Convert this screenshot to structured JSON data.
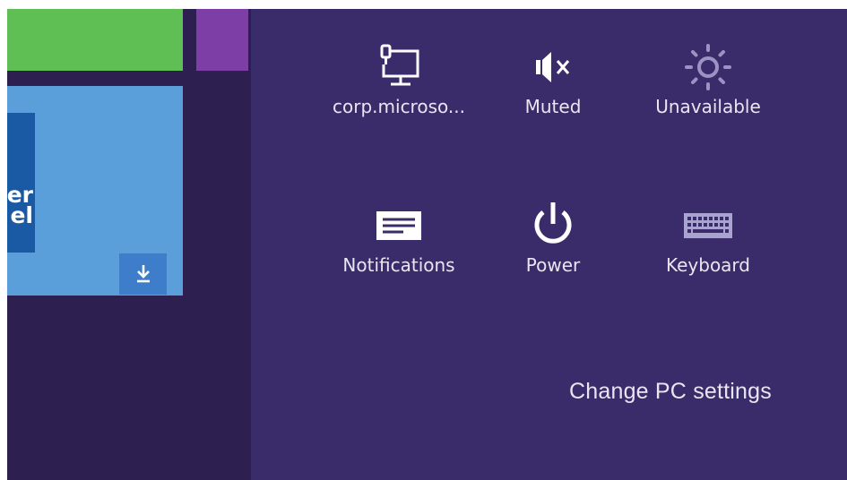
{
  "start_tiles": {
    "panel_tile_text": "er\nel"
  },
  "settings_charm": {
    "quick_settings": [
      {
        "label": "corp.microso...",
        "icon": "network-icon"
      },
      {
        "label": "Muted",
        "icon": "volume-muted-icon"
      },
      {
        "label": "Unavailable",
        "icon": "brightness-icon"
      },
      {
        "label": "Notifications",
        "icon": "notifications-icon"
      },
      {
        "label": "Power",
        "icon": "power-icon"
      },
      {
        "label": "Keyboard",
        "icon": "keyboard-icon"
      }
    ],
    "change_pc_settings": "Change PC settings"
  },
  "colors": {
    "charm_bg": "#3a2c6a",
    "start_bg": "#2d1f4f",
    "tile_green": "#5fbf55",
    "tile_purple": "#7d3ea6",
    "tile_blue": "#5b9fda"
  }
}
